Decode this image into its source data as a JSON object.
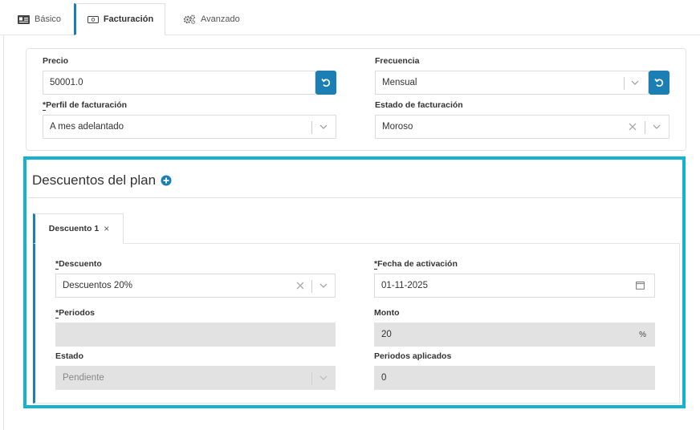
{
  "tabs": [
    {
      "label": "Básico",
      "icon": "id-card-icon"
    },
    {
      "label": "Facturación",
      "icon": "money-bill-icon"
    },
    {
      "label": "Avanzado",
      "icon": "gears-icon"
    }
  ],
  "billing": {
    "precio": {
      "label": "Precio",
      "value": "50001.0"
    },
    "frecuencia": {
      "label": "Frecuencia",
      "value": "Mensual"
    },
    "perfil": {
      "required_mark": "*",
      "label": "Perfil de facturación",
      "value": "A mes adelantado"
    },
    "estado": {
      "label": "Estado de facturación",
      "value": "Moroso"
    }
  },
  "discounts": {
    "title": "Descuentos del plan",
    "tab": {
      "label": "Descuento 1",
      "close": "×"
    },
    "descuento": {
      "required_mark": "*",
      "label": "Descuento",
      "value": "Descuentos 20%"
    },
    "fecha": {
      "required_mark": "*",
      "label": "Fecha de activación",
      "value": "01-11-2025"
    },
    "periodos": {
      "required_mark": "*",
      "label": "Periodos",
      "value": ""
    },
    "monto": {
      "label": "Monto",
      "value": "20",
      "unit": "%"
    },
    "estado": {
      "label": "Estado",
      "value": "Pendiente"
    },
    "periodos_aplicados": {
      "label": "Periodos aplicados",
      "value": "0"
    }
  },
  "colors": {
    "accent": "#1b7fb3",
    "highlight": "#16b3cf"
  }
}
